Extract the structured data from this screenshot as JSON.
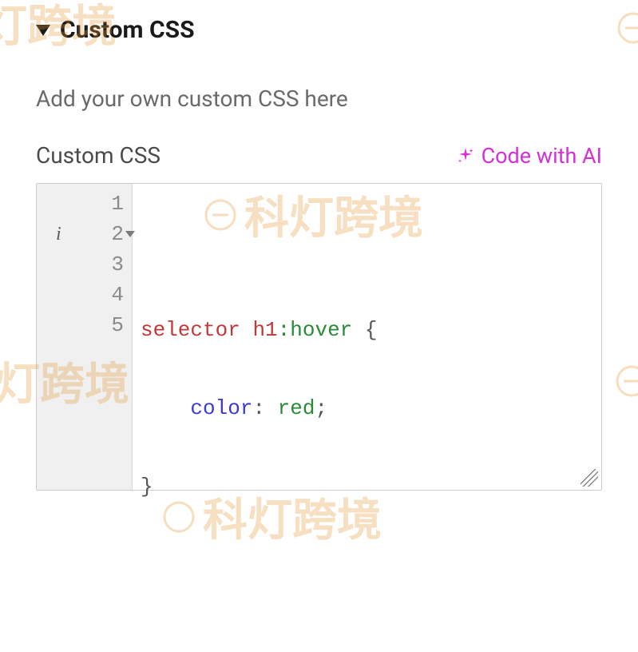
{
  "section": {
    "title": "Custom CSS",
    "description": "Add your own custom CSS here",
    "label": "Custom CSS",
    "code_ai_label": "Code with AI"
  },
  "editor": {
    "lines": [
      "1",
      "2",
      "3",
      "4",
      "5"
    ],
    "code": {
      "line2": {
        "selector_keyword": "selector",
        "tag": "h1",
        "pseudo": ":hover",
        "open": "{"
      },
      "line3": {
        "indent": "    ",
        "property": "color",
        "colon": ":",
        "value": " red",
        "semi": ";"
      },
      "line4": {
        "close": "}"
      }
    }
  },
  "watermark": {
    "text_full": "科灯跨境",
    "text_partial_right": "科",
    "text_partial_left": "灯跨境",
    "text_lamp": "灯跨境"
  }
}
